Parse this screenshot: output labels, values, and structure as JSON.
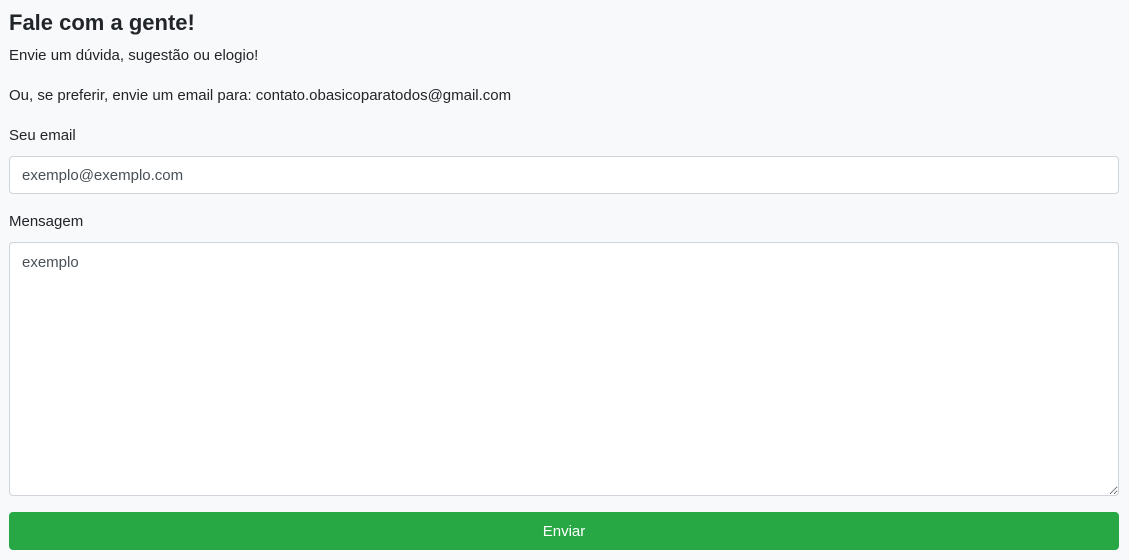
{
  "header": {
    "title": "Fale com a gente!",
    "subtitle": "Envie um dúvida, sugestão ou elogio!",
    "email_note": "Ou, se preferir, envie um email para: contato.obasicoparatodos@gmail.com"
  },
  "form": {
    "email_label": "Seu email",
    "email_placeholder": "exemplo@exemplo.com",
    "message_label": "Mensagem",
    "message_placeholder": "exemplo",
    "submit_label": "Enviar"
  },
  "colors": {
    "background": "#f8f9fa",
    "submit": "#28a745",
    "input_border": "#ced4da"
  }
}
